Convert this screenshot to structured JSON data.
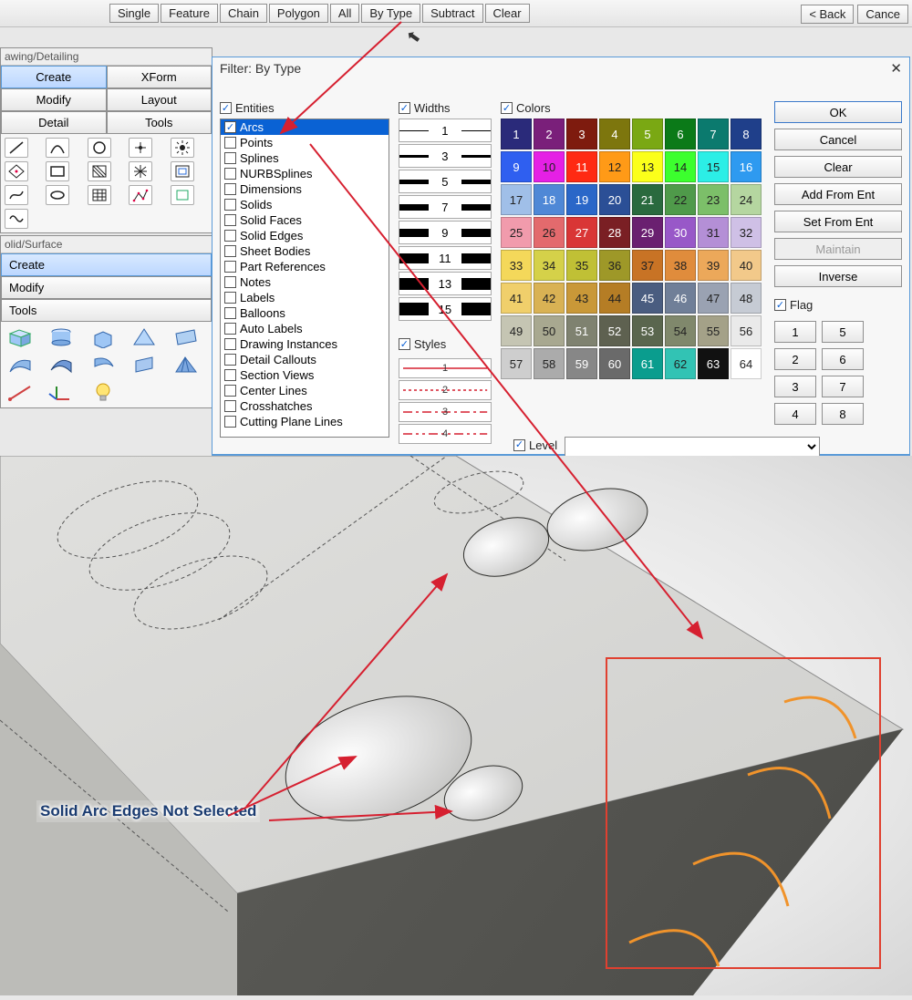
{
  "toolbar": {
    "buttons": [
      "Single",
      "Feature",
      "Chain",
      "Polygon",
      "All",
      "By Type",
      "Subtract",
      "Clear"
    ],
    "back": "< Back",
    "cancel": "Cance"
  },
  "palette_drawing": {
    "title": "awing/Detailing",
    "tabs": [
      "Create",
      "XForm",
      "Modify",
      "Layout",
      "Detail",
      "Tools"
    ]
  },
  "palette_solid": {
    "title": "olid/Surface",
    "tabs": [
      "Create",
      "Modify",
      "Tools"
    ]
  },
  "dialog": {
    "title": "Filter: By Type",
    "entities_label": "Entities",
    "entities": [
      "Arcs",
      "Points",
      "Splines",
      "NURBSplines",
      "Dimensions",
      "Solids",
      "Solid Faces",
      "Solid Edges",
      "Sheet Bodies",
      "Part References",
      "Notes",
      "Labels",
      "Balloons",
      "Auto Labels",
      "Drawing Instances",
      "Detail Callouts",
      "Section Views",
      "Center Lines",
      "Crosshatches",
      "Cutting Plane Lines"
    ],
    "widths_label": "Widths",
    "widths": [
      "1",
      "3",
      "5",
      "7",
      "9",
      "11",
      "13",
      "15"
    ],
    "styles_label": "Styles",
    "styles": [
      "1",
      "2",
      "3",
      "4"
    ],
    "colors_label": "Colors",
    "colors": [
      {
        "n": "1",
        "c": "#2a2a7a",
        "fg": "#fff"
      },
      {
        "n": "2",
        "c": "#7a1f7a",
        "fg": "#fff"
      },
      {
        "n": "3",
        "c": "#7e1b0e",
        "fg": "#fff"
      },
      {
        "n": "4",
        "c": "#7d760d",
        "fg": "#fff"
      },
      {
        "n": "5",
        "c": "#7aa813",
        "fg": "#fff"
      },
      {
        "n": "6",
        "c": "#0b7a18",
        "fg": "#fff"
      },
      {
        "n": "7",
        "c": "#0b7a6e",
        "fg": "#fff"
      },
      {
        "n": "8",
        "c": "#1f3f8a",
        "fg": "#fff"
      },
      {
        "n": "9",
        "c": "#2f5ff0",
        "fg": "#fff"
      },
      {
        "n": "10",
        "c": "#e520e5",
        "fg": "#222"
      },
      {
        "n": "11",
        "c": "#ff2a13",
        "fg": "#fff"
      },
      {
        "n": "12",
        "c": "#ff9a17",
        "fg": "#222"
      },
      {
        "n": "13",
        "c": "#fbff1a",
        "fg": "#222"
      },
      {
        "n": "14",
        "c": "#3cff2e",
        "fg": "#222"
      },
      {
        "n": "15",
        "c": "#2ceee6",
        "fg": "#222"
      },
      {
        "n": "16",
        "c": "#2e9af0",
        "fg": "#fff"
      },
      {
        "n": "17",
        "c": "#a0bfe8",
        "fg": "#222"
      },
      {
        "n": "18",
        "c": "#4f88d6",
        "fg": "#fff"
      },
      {
        "n": "19",
        "c": "#2a67c8",
        "fg": "#fff"
      },
      {
        "n": "20",
        "c": "#2b4f96",
        "fg": "#fff"
      },
      {
        "n": "21",
        "c": "#2a6a3e",
        "fg": "#fff"
      },
      {
        "n": "22",
        "c": "#4f9a4a",
        "fg": "#222"
      },
      {
        "n": "23",
        "c": "#7cbf69",
        "fg": "#222"
      },
      {
        "n": "24",
        "c": "#b5d6a0",
        "fg": "#222"
      },
      {
        "n": "25",
        "c": "#f19bac",
        "fg": "#222"
      },
      {
        "n": "26",
        "c": "#e36a6d",
        "fg": "#222"
      },
      {
        "n": "27",
        "c": "#d93636",
        "fg": "#fff"
      },
      {
        "n": "28",
        "c": "#7a1f24",
        "fg": "#fff"
      },
      {
        "n": "29",
        "c": "#6a2070",
        "fg": "#fff"
      },
      {
        "n": "30",
        "c": "#9858c8",
        "fg": "#fff"
      },
      {
        "n": "31",
        "c": "#b48fd6",
        "fg": "#222"
      },
      {
        "n": "32",
        "c": "#cfc0e6",
        "fg": "#222"
      },
      {
        "n": "33",
        "c": "#f4d85a",
        "fg": "#222"
      },
      {
        "n": "34",
        "c": "#d5d149",
        "fg": "#222"
      },
      {
        "n": "35",
        "c": "#c0c035",
        "fg": "#222"
      },
      {
        "n": "36",
        "c": "#9e9828",
        "fg": "#222"
      },
      {
        "n": "37",
        "c": "#c87325",
        "fg": "#222"
      },
      {
        "n": "38",
        "c": "#e08c3c",
        "fg": "#222"
      },
      {
        "n": "39",
        "c": "#eca85a",
        "fg": "#222"
      },
      {
        "n": "40",
        "c": "#f2c98a",
        "fg": "#222"
      },
      {
        "n": "41",
        "c": "#f0cf6b",
        "fg": "#222"
      },
      {
        "n": "42",
        "c": "#d9b254",
        "fg": "#222"
      },
      {
        "n": "43",
        "c": "#c99838",
        "fg": "#222"
      },
      {
        "n": "44",
        "c": "#b57d25",
        "fg": "#222"
      },
      {
        "n": "45",
        "c": "#4a5d80",
        "fg": "#fff"
      },
      {
        "n": "46",
        "c": "#707f98",
        "fg": "#fff"
      },
      {
        "n": "47",
        "c": "#9aa2b2",
        "fg": "#222"
      },
      {
        "n": "48",
        "c": "#c6cbd4",
        "fg": "#222"
      },
      {
        "n": "49",
        "c": "#c5c5b3",
        "fg": "#222"
      },
      {
        "n": "50",
        "c": "#a8a890",
        "fg": "#222"
      },
      {
        "n": "51",
        "c": "#7f8270",
        "fg": "#fff"
      },
      {
        "n": "52",
        "c": "#5e6150",
        "fg": "#fff"
      },
      {
        "n": "53",
        "c": "#5a664e",
        "fg": "#fff"
      },
      {
        "n": "54",
        "c": "#80886c",
        "fg": "#222"
      },
      {
        "n": "55",
        "c": "#a4a188",
        "fg": "#222"
      },
      {
        "n": "56",
        "c": "#eaeaea",
        "fg": "#222"
      },
      {
        "n": "57",
        "c": "#cecece",
        "fg": "#222"
      },
      {
        "n": "58",
        "c": "#ababab",
        "fg": "#222"
      },
      {
        "n": "59",
        "c": "#878787",
        "fg": "#fff"
      },
      {
        "n": "60",
        "c": "#6a6a6a",
        "fg": "#fff"
      },
      {
        "n": "61",
        "c": "#0a9d8e",
        "fg": "#fff"
      },
      {
        "n": "62",
        "c": "#32c3b4",
        "fg": "#222"
      },
      {
        "n": "63",
        "c": "#111111",
        "fg": "#fff"
      },
      {
        "n": "64",
        "c": "#ffffff",
        "fg": "#222"
      }
    ],
    "level_label": "Level",
    "ok": "OK",
    "cancel": "Cancel",
    "clear": "Clear",
    "add_from_ent": "Add From Ent",
    "set_from_ent": "Set From Ent",
    "maintain": "Maintain",
    "inverse": "Inverse",
    "flag_label": "Flag",
    "flags": [
      "1",
      "5",
      "2",
      "6",
      "3",
      "7",
      "4",
      "8"
    ]
  },
  "annotation": "Solid Arc Edges Not Selected"
}
